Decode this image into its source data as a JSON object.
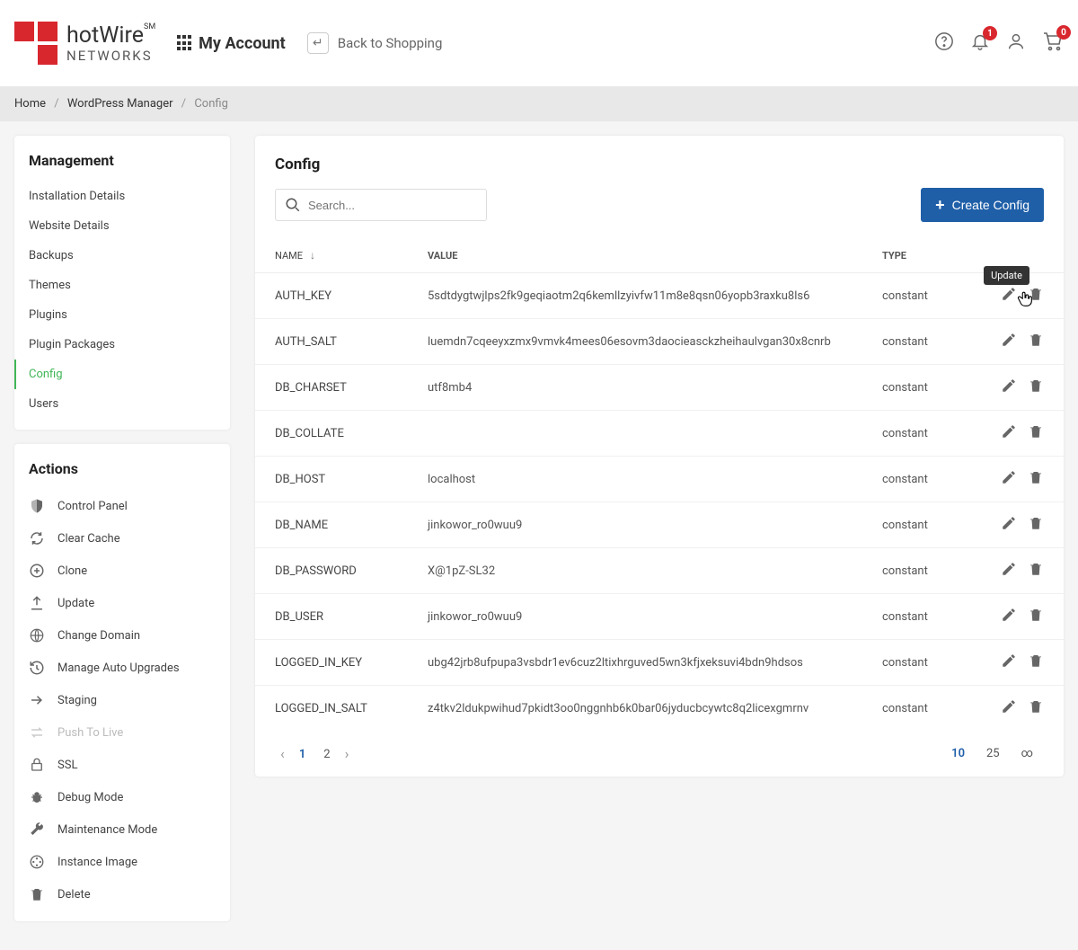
{
  "header": {
    "brand_main": "hotWire",
    "brand_sm": "SM",
    "brand_sub": "NETWORKS",
    "my_account": "My Account",
    "back_label": "Back to Shopping",
    "notif_count": "1",
    "cart_count": "0"
  },
  "breadcrumb": {
    "home": "Home",
    "mgr": "WordPress Manager",
    "current": "Config"
  },
  "sidebar": {
    "mgmt_title": "Management",
    "items": [
      {
        "label": "Installation Details"
      },
      {
        "label": "Website Details"
      },
      {
        "label": "Backups"
      },
      {
        "label": "Themes"
      },
      {
        "label": "Plugins"
      },
      {
        "label": "Plugin Packages"
      },
      {
        "label": "Config",
        "active": true
      },
      {
        "label": "Users"
      }
    ],
    "actions_title": "Actions",
    "actions": [
      {
        "label": "Control Panel",
        "icon": "shield"
      },
      {
        "label": "Clear Cache",
        "icon": "refresh"
      },
      {
        "label": "Clone",
        "icon": "plus-circle"
      },
      {
        "label": "Update",
        "icon": "upload"
      },
      {
        "label": "Change Domain",
        "icon": "globe"
      },
      {
        "label": "Manage Auto Upgrades",
        "icon": "history"
      },
      {
        "label": "Staging",
        "icon": "arrow-right"
      },
      {
        "label": "Push To Live",
        "icon": "swap",
        "disabled": true
      },
      {
        "label": "SSL",
        "icon": "lock"
      },
      {
        "label": "Debug Mode",
        "icon": "bug"
      },
      {
        "label": "Maintenance Mode",
        "icon": "wrench"
      },
      {
        "label": "Instance Image",
        "icon": "film"
      },
      {
        "label": "Delete",
        "icon": "trash"
      }
    ]
  },
  "panel": {
    "title": "Config",
    "search_placeholder": "Search...",
    "create_label": "Create Config",
    "tooltip_update": "Update",
    "columns": {
      "name": "NAME",
      "value": "VALUE",
      "type": "TYPE"
    },
    "rows": [
      {
        "name": "AUTH_KEY",
        "value": "5sdtdygtwjlps2fk9geqiaotm2q6kemllzyivfw11m8e8qsn06yopb3raxku8ls6",
        "type": "constant"
      },
      {
        "name": "AUTH_SALT",
        "value": "luemdn7cqeeyxzmx9vmvk4mees06esovm3daocieasckzheihaulvgan30x8cnrb",
        "type": "constant"
      },
      {
        "name": "DB_CHARSET",
        "value": "utf8mb4",
        "type": "constant"
      },
      {
        "name": "DB_COLLATE",
        "value": "",
        "type": "constant"
      },
      {
        "name": "DB_HOST",
        "value": "localhost",
        "type": "constant"
      },
      {
        "name": "DB_NAME",
        "value": "jinkowor_ro0wuu9",
        "type": "constant"
      },
      {
        "name": "DB_PASSWORD",
        "value": "X@1pZ-SL32",
        "type": "constant"
      },
      {
        "name": "DB_USER",
        "value": "jinkowor_ro0wuu9",
        "type": "constant"
      },
      {
        "name": "LOGGED_IN_KEY",
        "value": "ubg42jrb8ufpupa3vsbdr1ev6cuz2ltixhrguved5wn3kfjxeksuvi4bdn9hdsos",
        "type": "constant"
      },
      {
        "name": "LOGGED_IN_SALT",
        "value": "z4tkv2ldukpwihud7pkidt3oo0nggnhb6k0bar06jyducbcywtc8q2licexgmrnv",
        "type": "constant"
      }
    ],
    "pager": {
      "pages": [
        "1",
        "2"
      ],
      "active_page": "1",
      "sizes": [
        "10",
        "25",
        "∞"
      ],
      "active_size": "10"
    }
  }
}
